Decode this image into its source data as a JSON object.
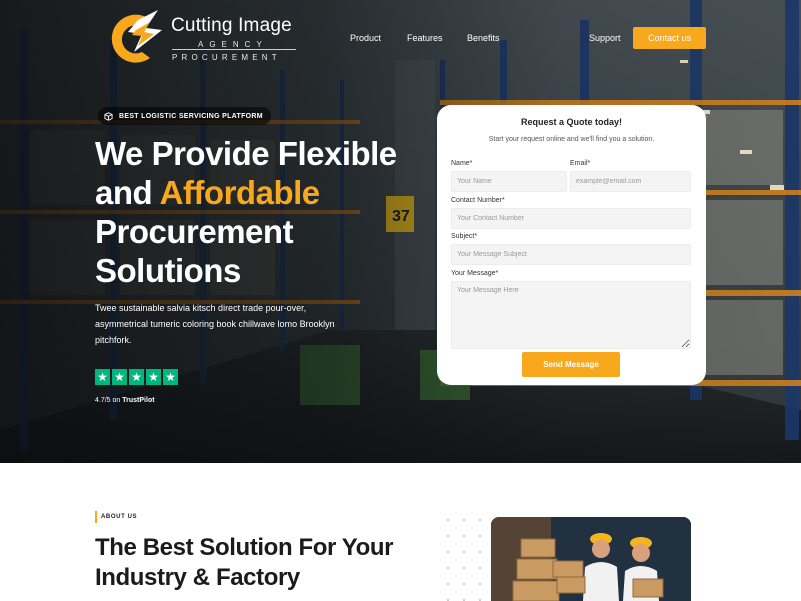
{
  "brand": {
    "name": "Cutting Image",
    "line2": "AGENCY",
    "line3": "PROCUREMENT"
  },
  "nav": {
    "items": [
      {
        "label": "Product"
      },
      {
        "label": "Features"
      },
      {
        "label": "Benefits"
      },
      {
        "label": "Support"
      }
    ],
    "cta_label": "Contact us"
  },
  "hero": {
    "badge_icon": "box-icon",
    "badge_text": "BEST LOGISTIC SERVICING PLATFORM",
    "headline_part1": "We Provide Flexible and ",
    "headline_accent": "Affordable",
    "headline_part2": " Procurement Solutions",
    "description": "Twee sustainable salvia kitsch direct trade pour-over, asymmetrical tumeric coloring book chillwave lomo Brooklyn pitchfork.",
    "stars": 5,
    "rating_value": "4.7/5",
    "rating_on": " on ",
    "rating_source": "TrustPilot"
  },
  "quote_form": {
    "title": "Request a Quote today!",
    "subtitle": "Start your request online and we'll find you a solution.",
    "name_label": "Name*",
    "name_placeholder": "Your Name",
    "email_label": "Email*",
    "email_placeholder": "example@email.com",
    "contact_label": "Contact Number*",
    "contact_placeholder": "Your Contact Number",
    "subject_label": "Subject*",
    "subject_placeholder": "Your Message Subject",
    "message_label": "Your Message*",
    "message_placeholder": "Your Message Here",
    "submit_label": "Send Message"
  },
  "about": {
    "tag": "ABOUT US",
    "title": "The Best Solution For Your Industry & Factory"
  },
  "colors": {
    "accent": "#f8a81c",
    "trustpilot_green": "#00b67a"
  }
}
